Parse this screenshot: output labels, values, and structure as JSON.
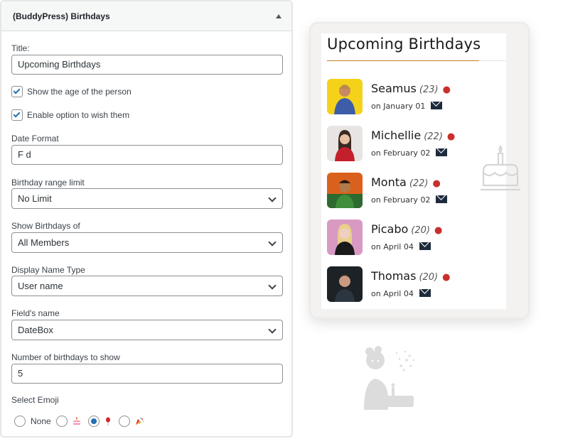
{
  "widget": {
    "title": "(BuddyPress) Birthdays",
    "title_label": "Title:",
    "title_value": "Upcoming Birthdays",
    "show_age_label": "Show the age of the person",
    "show_age_checked": true,
    "wish_label": "Enable option to wish them",
    "wish_checked": true,
    "date_format_label": "Date Format",
    "date_format_value": "F d",
    "range_label": "Birthday range limit",
    "range_value": "No Limit",
    "show_of_label": "Show Birthdays of",
    "show_of_value": "All Members",
    "name_type_label": "Display Name Type",
    "name_type_value": "User name",
    "field_label": "Field's name",
    "field_value": "DateBox",
    "count_label": "Number of birthdays to show",
    "count_value": "5",
    "emoji_label": "Select Emoji",
    "emoji_options": [
      {
        "label": "None",
        "icon": "",
        "checked": false
      },
      {
        "label": "",
        "icon": "cake-emoji",
        "checked": false
      },
      {
        "label": "",
        "icon": "balloon-emoji",
        "checked": true
      },
      {
        "label": "",
        "icon": "party-popper-emoji",
        "checked": false
      }
    ]
  },
  "card": {
    "title": "Upcoming Birthdays",
    "accent": "#c6802d",
    "people": [
      {
        "name": "Seamus",
        "age": "(23)",
        "date": "on January 01",
        "avatar_bg": "#f5d21a"
      },
      {
        "name": "Michellie",
        "age": "(22)",
        "date": "on February 02",
        "avatar_bg": "#e8e4e3"
      },
      {
        "name": "Monta",
        "age": "(22)",
        "date": "on February 02",
        "avatar_bg": "#d9611d"
      },
      {
        "name": "Picabo",
        "age": "(20)",
        "date": "on April 04",
        "avatar_bg": "#d89ac2"
      },
      {
        "name": "Thomas",
        "age": "(20)",
        "date": "on April 04",
        "avatar_bg": "#1c2226"
      }
    ]
  }
}
